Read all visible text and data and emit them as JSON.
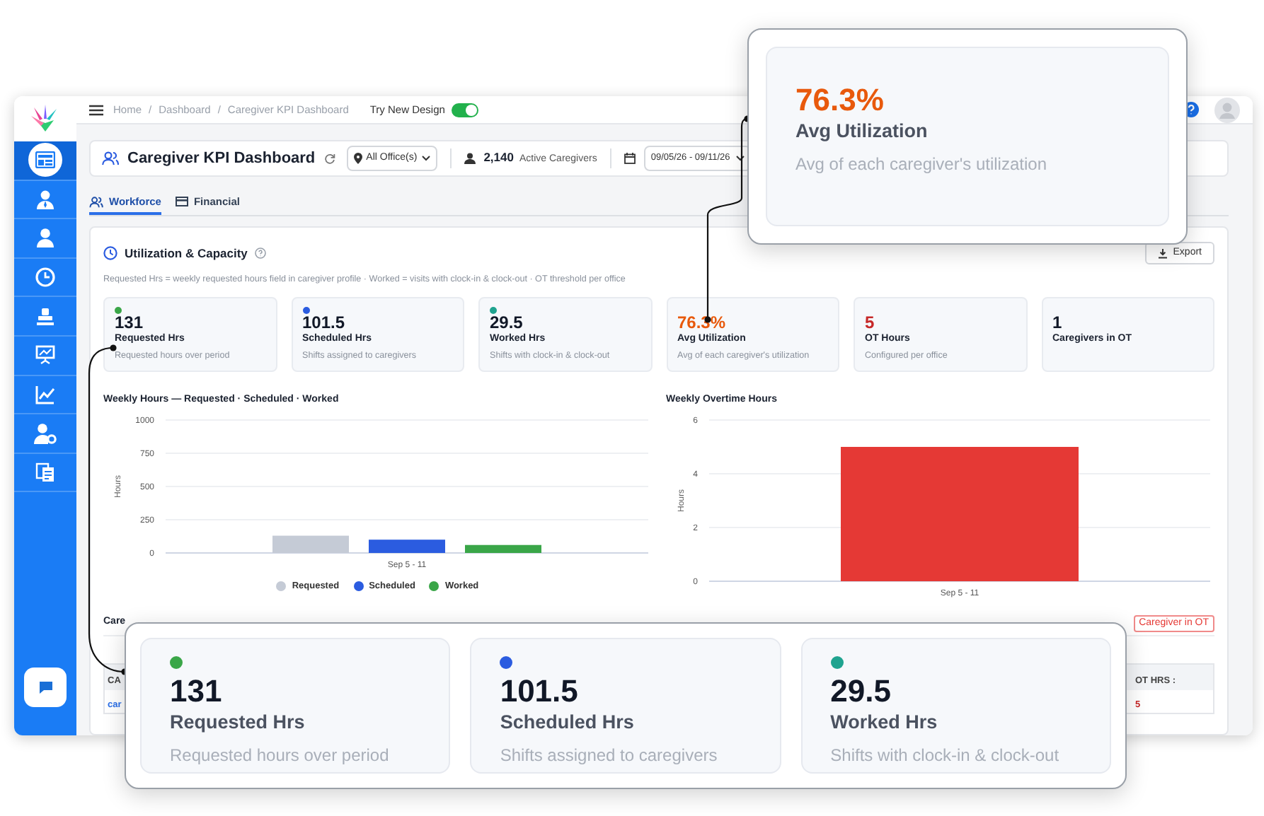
{
  "sidebar": {
    "items": [
      {
        "kind": "layout",
        "selected": true
      },
      {
        "kind": "user-tie",
        "selected": false
      },
      {
        "kind": "user",
        "selected": false
      },
      {
        "kind": "clock",
        "selected": false
      },
      {
        "kind": "stamp",
        "selected": false
      },
      {
        "kind": "board",
        "selected": false
      },
      {
        "kind": "chart",
        "selected": false
      },
      {
        "kind": "user-gear",
        "selected": false
      },
      {
        "kind": "docs",
        "selected": false
      }
    ]
  },
  "topbar": {
    "breadcrumbs": [
      "Home",
      "Dashboard",
      "Caregiver KPI Dashboard"
    ],
    "separator": "/",
    "toggle": {
      "label": "Try New Design",
      "on": true
    }
  },
  "header": {
    "title": "Caregiver KPI Dashboard",
    "office_filter": "All Office(s)",
    "active_count": "2,140",
    "active_label": "Active Caregivers",
    "date_range": "09/05/26 - 09/11/26"
  },
  "tabs": [
    {
      "label": "Workforce",
      "selected": true
    },
    {
      "label": "Financial",
      "selected": false
    }
  ],
  "section": {
    "title": "Utilization & Capacity",
    "export": "Export",
    "note": "Requested Hrs = weekly requested hours field in caregiver profile · Worked = visits with clock-in & clock-out · OT threshold per office"
  },
  "stats": [
    {
      "value": "131",
      "label": "Requested Hrs",
      "description": "Requested hours over period",
      "color": "#3aa648"
    },
    {
      "value": "101.5",
      "label": "Scheduled Hrs",
      "description": "Shifts assigned to caregivers",
      "color": "#2b5ce0"
    },
    {
      "value": "29.5",
      "label": "Worked Hrs",
      "description": "Shifts with clock-in & clock-out",
      "color": "#1fa38f"
    },
    {
      "value": {
        "text": "76.3%",
        "color": "#e8590c"
      },
      "label": "Avg Utilization",
      "description": "Avg of each caregiver's utilization"
    },
    {
      "value": {
        "text": "5",
        "color": "#c62828"
      },
      "label": "OT Hours",
      "description": "Configured per office"
    },
    {
      "value": "1",
      "label": "Caregivers in OT"
    }
  ],
  "charts": [
    {
      "chart_data": {
        "type": "bar",
        "title": "Weekly Hours — Requested · Scheduled · Worked",
        "ylabel": "Hours",
        "categories": [
          "Sep 5 - 11"
        ],
        "ylim": [
          0,
          1000
        ],
        "yticks": [
          0,
          250,
          500,
          750,
          1000
        ],
        "grid": true,
        "series": [
          {
            "name": "Requested",
            "color": "#c5cbd6",
            "values": [
              130
            ]
          },
          {
            "name": "Scheduled",
            "color": "#2b5ce0",
            "values": [
              100
            ]
          },
          {
            "name": "Worked",
            "color": "#3aa648",
            "values": [
              60
            ]
          }
        ]
      }
    },
    {
      "chart_data": {
        "type": "bar",
        "title": "Weekly Overtime Hours",
        "ylabel": "Hours",
        "categories": [
          "Sep 5 - 11"
        ],
        "ylim": [
          0,
          6
        ],
        "yticks": [
          0,
          2,
          4,
          6
        ],
        "grid": true,
        "series": [
          {
            "color": "#e53935",
            "values": [
              5
            ]
          }
        ]
      }
    }
  ],
  "table_section": {
    "title": "Care",
    "badge": "Caregiver in OT",
    "columns": [
      "CA",
      "OT HRS :"
    ],
    "rows": [
      [
        "car",
        "5"
      ]
    ]
  },
  "callouts": [
    {
      "cards": [
        {
          "value": {
            "text": "76.3%",
            "color": "#e8590c"
          },
          "label": "Avg Utilization",
          "description": "Avg of each caregiver's utilization"
        }
      ]
    },
    {
      "cards": [
        {
          "value": "131",
          "label": "Requested Hrs",
          "description": "Requested hours over period",
          "color": "#3aa648"
        },
        {
          "value": "101.5",
          "label": "Scheduled Hrs",
          "description": "Shifts assigned to caregivers",
          "color": "#2b5ce0"
        },
        {
          "value": "29.5",
          "label": "Worked Hrs",
          "description": "Shifts with clock-in & clock-out",
          "color": "#1fa38f"
        }
      ]
    }
  ]
}
